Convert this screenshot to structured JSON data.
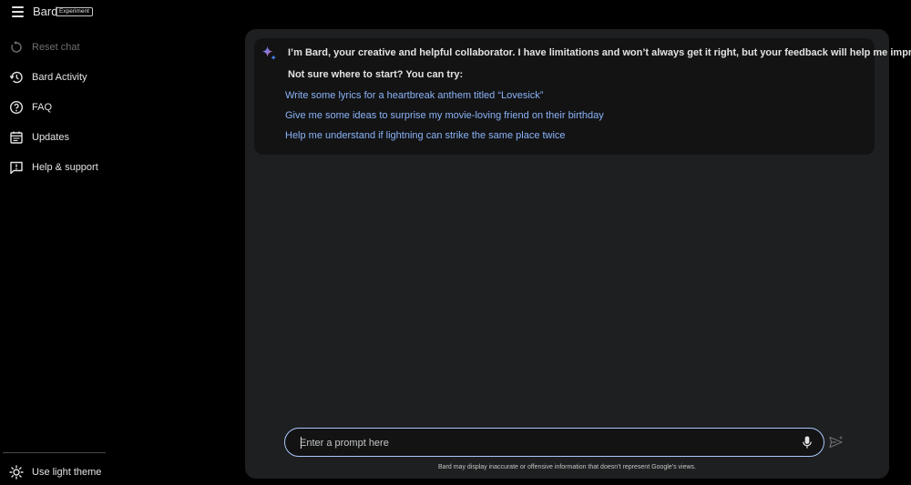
{
  "header": {
    "brand": "Bard",
    "badge": "Experiment"
  },
  "sidebar": {
    "items": [
      {
        "label": "Reset chat",
        "icon": "reset-icon",
        "disabled": true
      },
      {
        "label": "Bard Activity",
        "icon": "history-icon"
      },
      {
        "label": "FAQ",
        "icon": "help-circle-icon"
      },
      {
        "label": "Updates",
        "icon": "calendar-icon"
      },
      {
        "label": "Help & support",
        "icon": "support-chat-icon"
      }
    ],
    "theme_toggle": {
      "label": "Use light theme",
      "icon": "sun-icon"
    }
  },
  "chat": {
    "intro": "I’m Bard, your creative and helpful collaborator. I have limitations and won’t always get it right, but your feedback will help me improve.",
    "subintro": "Not sure where to start? You can try:",
    "suggestions": [
      "Write some lyrics for a heartbreak anthem titled “Lovesick”",
      "Give me some ideas to surprise my movie-loving friend on their birthday",
      "Help me understand if lightning can strike the same place twice"
    ]
  },
  "input": {
    "placeholder": "Enter a prompt here",
    "value": ""
  },
  "disclaimer": "Bard may display inaccurate or offensive information that doesn’t represent Google’s views.",
  "colors": {
    "background": "#000000",
    "panel": "#1e1f20",
    "card": "#131314",
    "link": "#8ab4f8",
    "input_border": "#a8c7fa"
  }
}
